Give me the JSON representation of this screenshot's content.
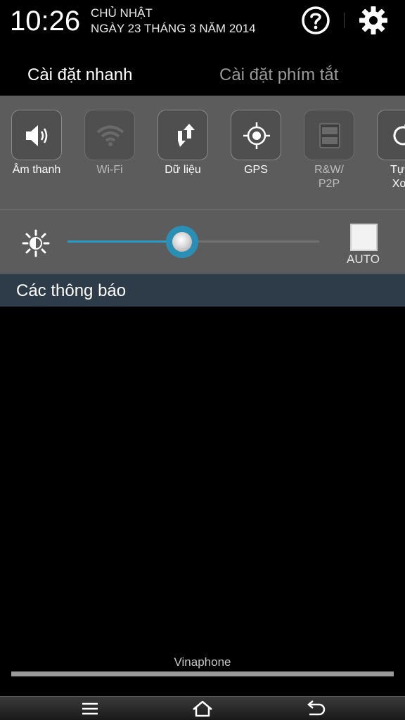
{
  "status": {
    "time": "10:26",
    "day": "CHỦ NHẬT",
    "date": "NGÀY 23 THÁNG 3 NĂM 2014",
    "icons": [
      "help-icon",
      "gear-icon"
    ]
  },
  "tabs": [
    {
      "label": "Cài đặt nhanh",
      "active": true
    },
    {
      "label": "Cài đặt phím tắt",
      "active": false
    }
  ],
  "quick_settings": [
    {
      "label": "Âm thanh",
      "icon": "speaker-icon",
      "enabled": true
    },
    {
      "label": "Wi-Fi",
      "icon": "wifi-icon",
      "enabled": false
    },
    {
      "label": "Dữ liệu",
      "icon": "data-transfer-icon",
      "enabled": true
    },
    {
      "label": "GPS",
      "icon": "gps-icon",
      "enabled": true
    },
    {
      "label": "R&W/",
      "label2": "P2P",
      "icon": "storage-icon",
      "enabled": false
    },
    {
      "label": "Tự đ",
      "label2": "Xoa",
      "icon": "auto-rotate-icon",
      "enabled": true
    }
  ],
  "brightness": {
    "level": 0.455,
    "auto_label": "AUTO",
    "accent": "#2b9dc4"
  },
  "notifications": {
    "title": "Các thông báo"
  },
  "carrier": "Vinaphone",
  "navbar": {
    "icons": [
      "menu-icon",
      "home-icon",
      "back-icon"
    ]
  }
}
